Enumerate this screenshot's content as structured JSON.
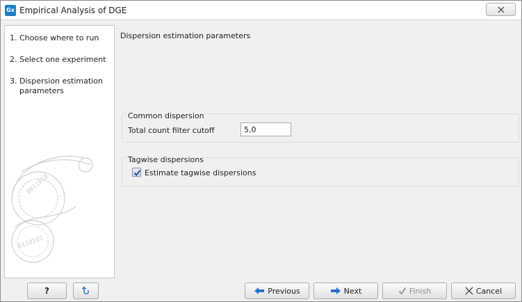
{
  "window": {
    "icon_text": "Gx",
    "title": "Empirical Analysis of DGE"
  },
  "sidebar": {
    "steps": [
      {
        "number": "1.",
        "label": "Choose where to run"
      },
      {
        "number": "2.",
        "label": "Select one experiment"
      },
      {
        "number": "3.",
        "label": "Dispersion estimation parameters"
      }
    ]
  },
  "main": {
    "heading": "Dispersion estimation parameters",
    "common_dispersion": {
      "title": "Common dispersion",
      "filter_label": "Total count filter cutoff",
      "filter_value": "5,0"
    },
    "tagwise_dispersions": {
      "title": "Tagwise dispersions",
      "checkbox_label": "Estimate tagwise dispersions",
      "checked": true
    }
  },
  "buttons": {
    "help": "?",
    "previous": "Previous",
    "next": "Next",
    "finish": "Finish",
    "cancel": "Cancel"
  },
  "colors": {
    "accent": "#1f7fc4",
    "arrow": "#2a6fc9",
    "check": "#1b3f8b"
  }
}
